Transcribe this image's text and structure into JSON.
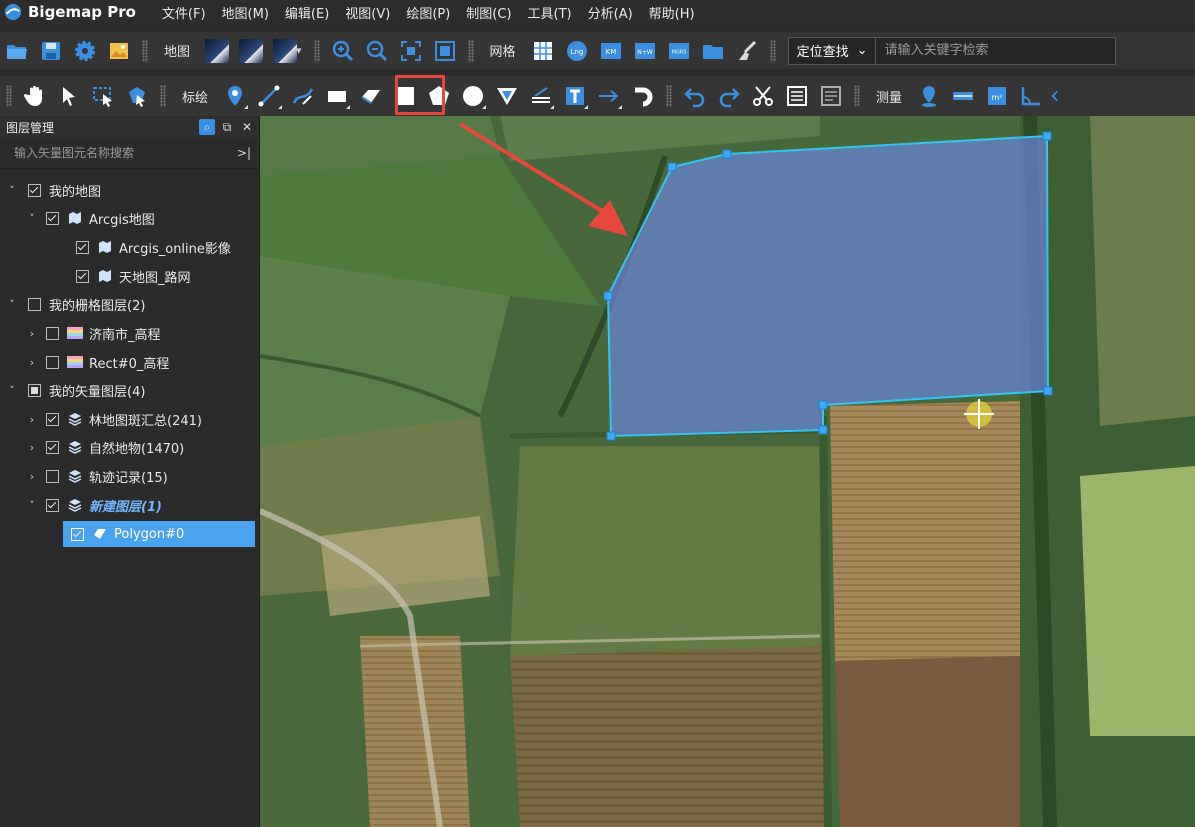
{
  "app": {
    "title": "Bigemap Pro"
  },
  "menu": [
    "文件(F)",
    "地图(M)",
    "编辑(E)",
    "视图(V)",
    "绘图(P)",
    "制图(C)",
    "工具(T)",
    "分析(A)",
    "帮助(H)"
  ],
  "toolbar1": {
    "map_label": "地图",
    "grid_label": "网格",
    "grid_icons": {
      "lng": "Lng",
      "km": "KM",
      "nw": "N+W",
      "mgrs": "MGRS"
    },
    "locate_select": "定位查找",
    "search_placeholder": "请输入关键字检索"
  },
  "toolbar2": {
    "annotate_label": "标绘",
    "measure_label": "测量"
  },
  "panel": {
    "title": "图层管理",
    "search_placeholder": "输入矢量图元名称搜索"
  },
  "layers": [
    {
      "label": "我的地图"
    },
    {
      "label": "Arcgis地图"
    },
    {
      "label": "Arcgis_online影像"
    },
    {
      "label": "天地图_路网"
    },
    {
      "label": "我的栅格图层(2)"
    },
    {
      "label": "济南市_高程"
    },
    {
      "label": "Rect#0_高程"
    },
    {
      "label": "我的矢量图层(4)"
    },
    {
      "label": "林地图斑汇总(241)"
    },
    {
      "label": "自然地物(1470)"
    },
    {
      "label": "轨迹记录(15)"
    },
    {
      "label": "新建图层(1)"
    },
    {
      "label": "Polygon#0"
    }
  ],
  "colors": {
    "highlight": "#e8483c",
    "polygon_fill": "#6a85d6",
    "polygon_stroke": "#33c4f0",
    "selection": "#4aa3ef"
  },
  "icons": [
    "open-folder-icon",
    "save-icon",
    "settings-gear-icon",
    "image-icon",
    "zoom-in-icon",
    "zoom-out-icon",
    "fit-extent-icon",
    "full-extent-icon",
    "grid-icon",
    "folder-icon",
    "clear-brush-icon",
    "hand-pan-icon",
    "pointer-icon",
    "select-box-icon",
    "select-polygon-icon",
    "marker-icon",
    "line-icon",
    "curve-icon",
    "rectangle-icon",
    "polygon-draw-icon",
    "square-icon",
    "pentagon-icon",
    "circle-icon",
    "triangle-icon",
    "dimension-icon",
    "text-icon",
    "arrow-icon",
    "curved-arrow-icon",
    "undo-icon",
    "redo-icon",
    "scissors-icon",
    "table-icon",
    "list-icon",
    "location-pin-icon",
    "distance-icon",
    "area-icon",
    "angle-icon"
  ]
}
